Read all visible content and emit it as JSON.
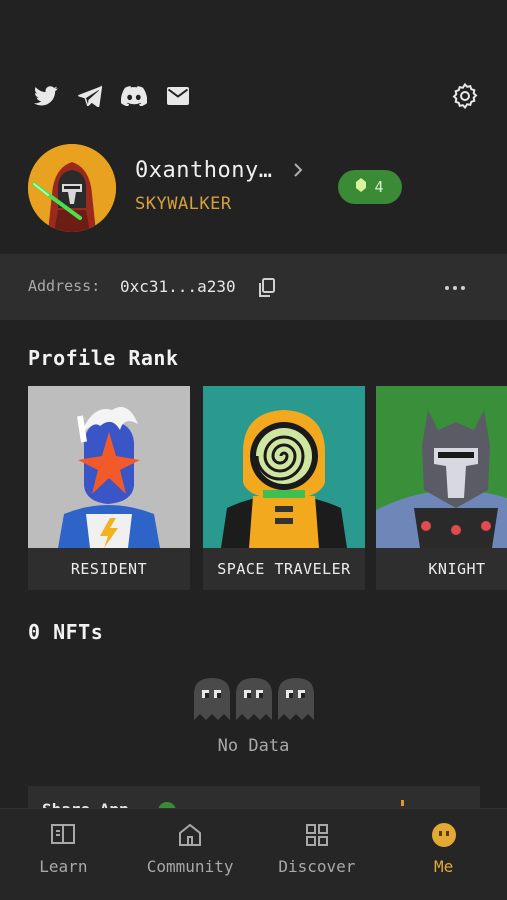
{
  "social": {
    "icons": [
      "twitter-icon",
      "telegram-icon",
      "discord-icon",
      "mail-icon"
    ],
    "settings_icon": "gear-icon"
  },
  "profile": {
    "username": "0xanthony…",
    "title": "SKYWALKER",
    "gem_count": "4"
  },
  "address": {
    "label": "Address:",
    "value": "0xc31...a230"
  },
  "rank": {
    "heading": "Profile Rank",
    "cards": [
      {
        "label": "RESIDENT"
      },
      {
        "label": "SPACE TRAVELER"
      },
      {
        "label": "KNIGHT"
      }
    ]
  },
  "nfts": {
    "heading": "0 NFTs",
    "empty_text": "No Data"
  },
  "share": {
    "label": "Share App"
  },
  "tabs": [
    {
      "label": "Learn",
      "icon": "book-icon",
      "active": false
    },
    {
      "label": "Community",
      "icon": "home-icon",
      "active": false
    },
    {
      "label": "Discover",
      "icon": "grid-icon",
      "active": false
    },
    {
      "label": "Me",
      "icon": "face-icon",
      "active": true
    }
  ],
  "colors": {
    "background": "#222222",
    "accent_gold": "#d8a03c",
    "gem_green": "#3a8a36",
    "active_tab": "#e3a934"
  }
}
